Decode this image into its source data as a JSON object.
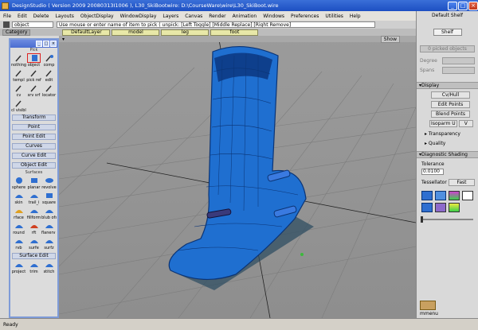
{
  "window": {
    "title": "DesignStudio ( Version 2009  20080313I1006 ), L30_SkiBootwire: D:\\CourseWare\\wire\\L30_SkiBoot.wire"
  },
  "menubar": [
    "File",
    "Edit",
    "Delete",
    "Layouts",
    "ObjectDisplay",
    "WindowDisplay",
    "Layers",
    "Canvas",
    "Render",
    "Animation",
    "Windows",
    "Preferences",
    "Utilities",
    "Help"
  ],
  "prompt": {
    "mode": "object",
    "text": "Use mouse or enter name of item to pick (  unpick: [Left Toggle] [Middle Replace] [Right Remove]"
  },
  "categories": {
    "label": "Category",
    "default_layer": "DefaultLayer",
    "layers": [
      "model",
      "leg",
      "foot"
    ]
  },
  "viewport": {
    "show_label": "Show"
  },
  "shelf": {
    "default_shelf": "Default Shelf",
    "tab": "Shelf",
    "picked": "0 picked objects",
    "degree_label": "Degree",
    "spans_label": "Spans"
  },
  "display": {
    "title": "Display",
    "items": [
      "Cv/Hull",
      "Edit Points",
      "Blend Points"
    ],
    "isoparm_label": "Isoparm U",
    "isoparm_v": "V",
    "transparency": "Transparency",
    "quality": "Quality"
  },
  "diagnostic": {
    "title": "Diagnostic Shading",
    "tolerance_label": "Tolerance",
    "tolerance_value": "0.0100",
    "tessellator_label": "Tessellator",
    "tessellator_value": "Fast"
  },
  "marking_menu": {
    "label": "mmenu"
  },
  "palette": {
    "pick_title": "Pick",
    "pick_labels": [
      "nothing",
      "object",
      "comp",
      "templ",
      "pick ref",
      "edit",
      "cv",
      "srv srf",
      "locator",
      "cl visibl"
    ],
    "transform": "Transform",
    "point": "Point",
    "point_edit": "Point Edit",
    "curves": "Curves",
    "curve_edit": "Curve Edit",
    "object_edit": "Object Edit",
    "surfaces": "Surfaces",
    "surface_labels": [
      "sphere",
      "planar",
      "revolve",
      "skin",
      "trail_i",
      "square",
      "rface",
      "fillform",
      "blub ofs",
      "round",
      "rft",
      "flanerv net",
      "rvb",
      "surfe",
      "surfz"
    ],
    "surface_edit": "Surface Edit",
    "surface_edit_labels": [
      "project",
      "trim",
      "stitch"
    ]
  },
  "status": {
    "text": "Ready"
  },
  "colors": {
    "boot": "#1f6fd0",
    "boot_dark": "#0e3f8c",
    "accent": "#3a6fd8"
  }
}
